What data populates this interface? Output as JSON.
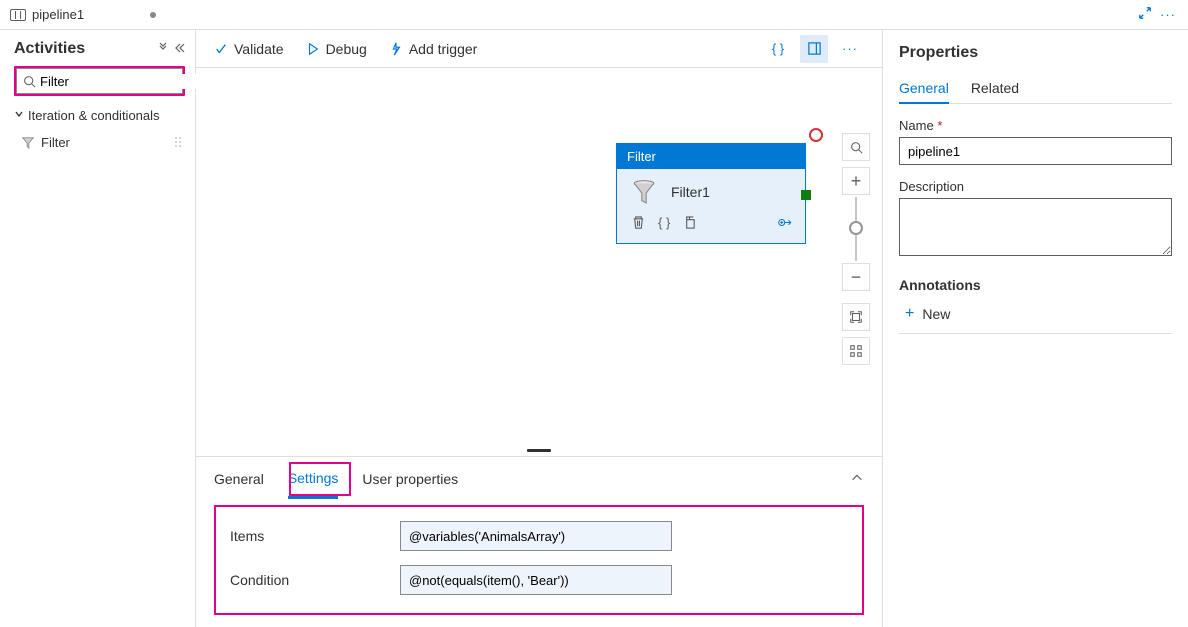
{
  "tab": {
    "name": "pipeline1"
  },
  "sidebar": {
    "title": "Activities",
    "search_value": "Filter",
    "category": "Iteration & conditionals",
    "item_label": "Filter"
  },
  "toolbar": {
    "validate": "Validate",
    "debug": "Debug",
    "add_trigger": "Add trigger"
  },
  "node": {
    "header": "Filter",
    "name": "Filter1"
  },
  "bottom": {
    "tabs": {
      "general": "General",
      "settings": "Settings",
      "user_props": "User properties"
    },
    "items_label": "Items",
    "condition_label": "Condition",
    "items_value": "@variables('AnimalsArray')",
    "condition_value": "@not(equals(item(), 'Bear'))"
  },
  "props": {
    "title": "Properties",
    "tabs": {
      "general": "General",
      "related": "Related"
    },
    "name_label": "Name",
    "name_value": "pipeline1",
    "desc_label": "Description",
    "annotations_label": "Annotations",
    "new_label": "New"
  }
}
